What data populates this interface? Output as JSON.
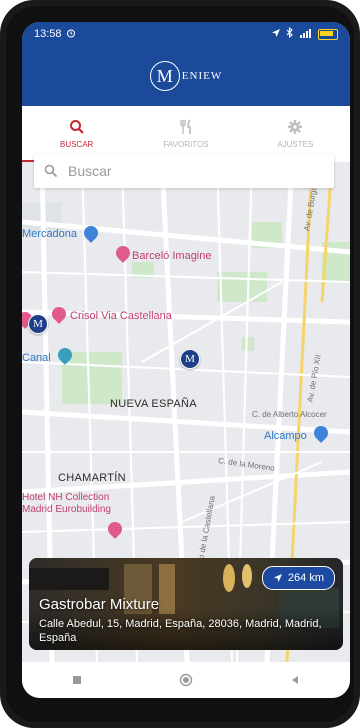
{
  "status_bar": {
    "time": "13:58"
  },
  "app_bar": {
    "logo_letter": "M",
    "logo_text": "ENIEW"
  },
  "tabs": [
    {
      "label": "BUSCAR",
      "icon": "search-icon",
      "active": true
    },
    {
      "label": "FAVORITOS",
      "icon": "cutlery-icon",
      "active": false
    },
    {
      "label": "AJUSTES",
      "icon": "gear-icon",
      "active": false
    }
  ],
  "search": {
    "placeholder": "Buscar"
  },
  "map": {
    "labels": {
      "mercadona": "Mercadona",
      "barcelo": "Barceló Imagine",
      "crisol": "Crisol Via Castellana",
      "canal": "Canal",
      "nueva_espana": "NUEVA ESPAÑA",
      "alcampo": "Alcampo",
      "chamartin": "CHAMARTÍN",
      "hotel_nh_1": "Hotel NH Collection",
      "hotel_nh_2": "Madrid Eurobuilding",
      "street_burgos": "Av. de Burgos",
      "street_pio_xii": "Av. de Pío XII",
      "street_alberto": "C. de Alberto Alcocer",
      "street_moreno": "C. de la Moreno",
      "street_castellana": "Paseo de la Castellana"
    },
    "menew_pin_letter": "M"
  },
  "card": {
    "title": "Gastrobar Mixture",
    "address": "Calle Abedul, 15, Madrid, España, 28036, Madrid, Madrid, España",
    "distance": "264 km"
  },
  "colors": {
    "brand_blue": "#1b4a9a",
    "accent_red": "#c6282e",
    "poi_pink": "#e0598f"
  }
}
